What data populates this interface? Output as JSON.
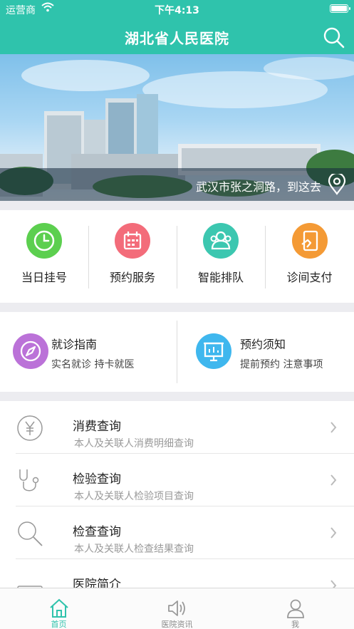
{
  "status_bar": {
    "carrier": "运营商",
    "time": "下午4:13"
  },
  "header": {
    "title": "湖北省人民医院",
    "search_icon": "search-icon"
  },
  "banner": {
    "address": "武汉市张之洞路，到这去",
    "location_icon": "map-pin-icon"
  },
  "quick_actions": [
    {
      "label": "当日挂号",
      "icon": "clock-icon",
      "color": "#5ccf4f"
    },
    {
      "label": "预约服务",
      "icon": "calendar-icon",
      "color": "#f36c7a"
    },
    {
      "label": "智能排队",
      "icon": "people-icon",
      "color": "#3cc7b0"
    },
    {
      "label": "诊间支付",
      "icon": "payment-icon",
      "color": "#f49a35"
    }
  ],
  "guides": [
    {
      "title": "就诊指南",
      "subtitle": "实名就诊  持卡就医",
      "icon": "compass-icon",
      "color": "#bb72d8"
    },
    {
      "title": "预约须知",
      "subtitle": "提前预约  注意事项",
      "icon": "presentation-icon",
      "color": "#3fb7ee"
    }
  ],
  "services": [
    {
      "title": "消费查询",
      "subtitle": "本人及关联人消费明细查询",
      "icon": "yen-icon"
    },
    {
      "title": "检验查询",
      "subtitle": "本人及关联人检验项目查询",
      "icon": "stethoscope-icon"
    },
    {
      "title": "检查查询",
      "subtitle": "本人及关联人检查结果查询",
      "icon": "magnifier-icon"
    },
    {
      "title": "医院简介",
      "subtitle": "",
      "icon": "document-icon"
    }
  ],
  "tabs": [
    {
      "label": "首页",
      "icon": "home-icon",
      "active": true
    },
    {
      "label": "医院资讯",
      "icon": "speaker-icon",
      "active": false
    },
    {
      "label": "我",
      "icon": "person-icon",
      "active": false
    }
  ],
  "colors": {
    "primary": "#2fc3ac",
    "muted_text": "#9a9a9a"
  }
}
